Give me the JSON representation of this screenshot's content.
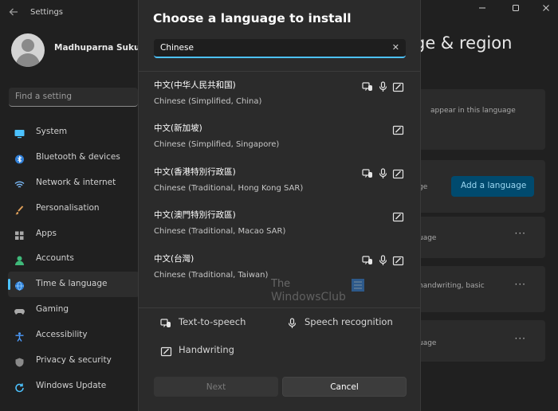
{
  "window": {
    "app_title": "Settings",
    "back_icon": "back-arrow-icon",
    "controls": [
      "minimize-icon",
      "maximize-icon",
      "close-icon"
    ]
  },
  "profile": {
    "name": "Madhuparna Sukul"
  },
  "search": {
    "placeholder": "Find a setting"
  },
  "sidebar": {
    "items": [
      {
        "label": "System",
        "icon": "system-icon",
        "color": "#4cc2ff"
      },
      {
        "label": "Bluetooth & devices",
        "icon": "bluetooth-icon",
        "color": "#4c9cff"
      },
      {
        "label": "Network & internet",
        "icon": "network-icon",
        "color": "#7ab8f5"
      },
      {
        "label": "Personalisation",
        "icon": "brush-icon",
        "color": "#e0a05a"
      },
      {
        "label": "Apps",
        "icon": "apps-icon",
        "color": "#a9a9a9"
      },
      {
        "label": "Accounts",
        "icon": "accounts-icon",
        "color": "#3fb97a"
      },
      {
        "label": "Time & language",
        "icon": "globe-icon",
        "color": "#4cc2ff",
        "active": true
      },
      {
        "label": "Gaming",
        "icon": "gaming-icon",
        "color": "#a9a9a9"
      },
      {
        "label": "Accessibility",
        "icon": "accessibility-icon",
        "color": "#4c9cff"
      },
      {
        "label": "Privacy & security",
        "icon": "shield-icon",
        "color": "#a9a9a9"
      },
      {
        "label": "Windows Update",
        "icon": "update-icon",
        "color": "#4cc2ff"
      }
    ]
  },
  "background": {
    "title_fragment": "ge & region",
    "card1_text": "appear in this language",
    "card2_text": "ge",
    "add_language_label": "Add a language",
    "card3_text": "uage",
    "card4_text": "handwriting, basic",
    "card5_text": "uage"
  },
  "dialog": {
    "title": "Choose a language to install",
    "search_value": "Chinese",
    "languages": [
      {
        "native": "中文(中华人民共和国)",
        "desc": "Chinese (Simplified, China)",
        "features": [
          "text-to-speech",
          "speech-recognition",
          "handwriting"
        ]
      },
      {
        "native": "中文(新加坡)",
        "desc": "Chinese (Simplified, Singapore)",
        "features": [
          "handwriting"
        ]
      },
      {
        "native": "中文(香港特別行政區)",
        "desc": "Chinese (Traditional, Hong Kong SAR)",
        "features": [
          "text-to-speech",
          "speech-recognition",
          "handwriting"
        ]
      },
      {
        "native": "中文(澳門特別行政區)",
        "desc": "Chinese (Traditional, Macao SAR)",
        "features": [
          "handwriting"
        ]
      },
      {
        "native": "中文(台灣)",
        "desc": "Chinese (Traditional, Taiwan)",
        "features": [
          "text-to-speech",
          "speech-recognition",
          "handwriting"
        ]
      }
    ],
    "legend": {
      "tts": "Text-to-speech",
      "speech": "Speech recognition",
      "handwriting": "Handwriting"
    },
    "next_label": "Next",
    "cancel_label": "Cancel"
  },
  "watermark": {
    "line1": "The",
    "line2": "WindowsClub"
  },
  "colors": {
    "accent": "#4cc2ff",
    "dialog_bg": "#2b2b2b",
    "window_bg": "#202020"
  }
}
